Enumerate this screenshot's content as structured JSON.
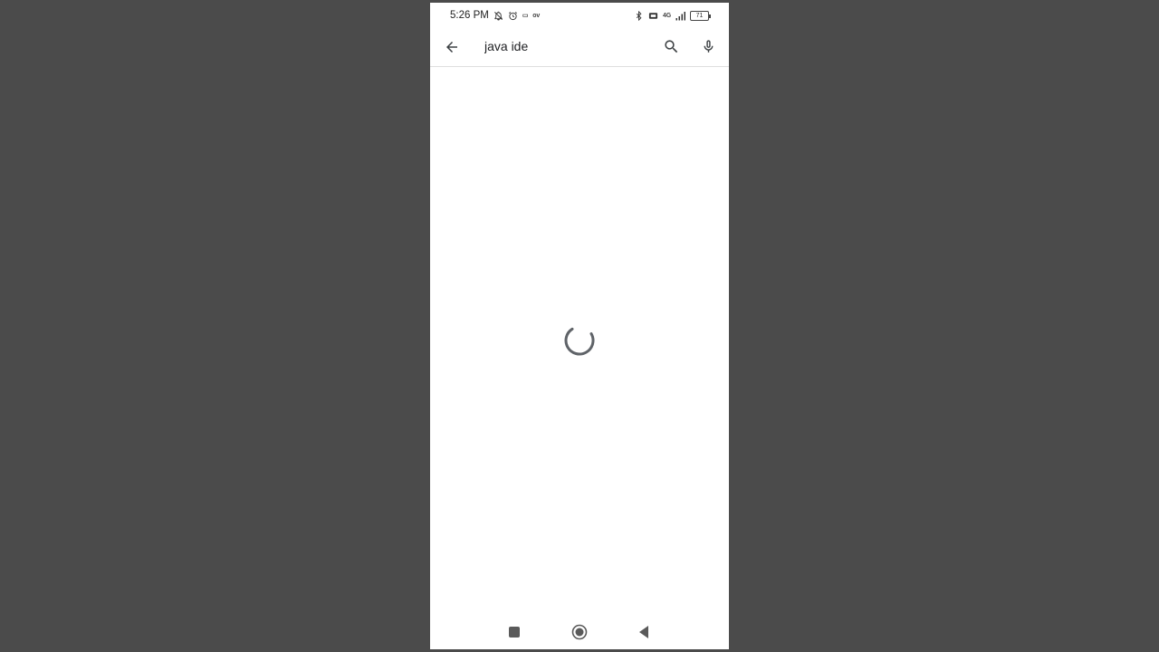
{
  "status_bar": {
    "time": "5:26 PM",
    "left_icons": [
      "bell-off-icon",
      "alarm-icon",
      "sim-icon",
      "data-saver-icon"
    ],
    "right_icons": [
      "bluetooth-icon",
      "volte-icon",
      "signal-4g-icon"
    ],
    "network_label": "4G",
    "battery_level": "71"
  },
  "search": {
    "query": "java ide",
    "back_icon": "arrow-back-icon",
    "search_icon": "search-icon",
    "mic_icon": "microphone-icon"
  },
  "content": {
    "state": "loading",
    "spinner_icon": "loading-spinner-icon"
  },
  "nav_bar": {
    "buttons": [
      "recents-button",
      "home-button",
      "back-button"
    ]
  },
  "colors": {
    "background": "#4b4b4b",
    "screen": "#ffffff",
    "icon": "#5f6368",
    "text": "#202124"
  }
}
